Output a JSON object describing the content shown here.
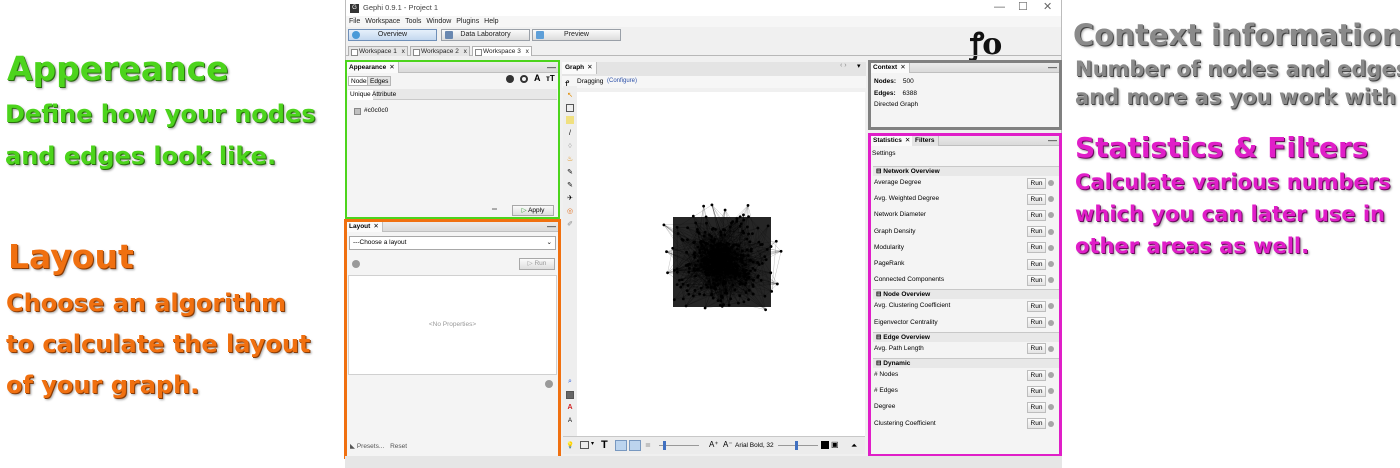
{
  "annotations": {
    "appearance": {
      "title": "Appereance",
      "line1": "Define how your nodes",
      "line2": "and edges look like."
    },
    "layout": {
      "title": "Layout",
      "line1": "Choose an algorithm",
      "line2": "to calculate the layout",
      "line3": "of your graph."
    },
    "context": {
      "title": "Context information",
      "line1": "Number of nodes and edges",
      "line2": "and more as you work with it."
    },
    "stats": {
      "title": "Statistics & Filters",
      "line1": "Calculate various numbers",
      "line2": "which you can later use in",
      "line3": "other areas as well."
    },
    "colors": {
      "appearance": "#4cd41c",
      "layout": "#f07010",
      "context": "#8a8a8a",
      "stats": "#e01ec8"
    }
  },
  "window": {
    "title": "Gephi 0.9.1 - Project 1",
    "app_icon": "gephi-icon",
    "controls": {
      "minimize": "—",
      "maximize": "☐",
      "close": "✕"
    },
    "logo": "ꝭo"
  },
  "menu": [
    "File",
    "Workspace",
    "Tools",
    "Window",
    "Plugins",
    "Help"
  ],
  "modes": [
    {
      "label": "Overview",
      "active": true
    },
    {
      "label": "Data Laboratory",
      "active": false
    },
    {
      "label": "Preview",
      "active": false
    }
  ],
  "workspaces": [
    {
      "label": "Workspace 1",
      "close": "x"
    },
    {
      "label": "Workspace 2",
      "close": "x"
    },
    {
      "label": "Workspace 3",
      "close": "x"
    }
  ],
  "appearance_panel": {
    "tab": "Appearance",
    "subtabs": [
      "Nodes",
      "Edges"
    ],
    "modes": [
      "Unique",
      "Attribute"
    ],
    "color_value": "#c0c0c0",
    "apply": "Apply",
    "icons": [
      "color-icon",
      "size-icon",
      "label-color-icon",
      "label-size-icon"
    ]
  },
  "layout_panel": {
    "tab": "Layout",
    "select_value": "---Choose a layout",
    "run": "Run",
    "no_properties": "<No Properties>",
    "presets": "Presets...",
    "reset": "Reset"
  },
  "graph_panel": {
    "tab": "Graph",
    "mode_label": "Dragging",
    "configure": "(Configure)",
    "font_label": "Arial Bold, 32"
  },
  "context_panel": {
    "tab": "Context",
    "nodes_label": "Nodes:",
    "nodes_value": "500",
    "edges_label": "Edges:",
    "edges_value": "6388",
    "graph_type": "Directed Graph"
  },
  "stats_panel": {
    "tabs": [
      "Statistics",
      "Filters"
    ],
    "settings": "Settings",
    "run_label": "Run",
    "sections": [
      {
        "title": "Network Overview",
        "items": [
          "Average Degree",
          "Avg. Weighted Degree",
          "Network Diameter",
          "Graph Density",
          "Modularity",
          "PageRank",
          "Connected Components"
        ]
      },
      {
        "title": "Node Overview",
        "items": [
          "Avg. Clustering Coefficient",
          "Eigenvector Centrality"
        ]
      },
      {
        "title": "Edge Overview",
        "items": [
          "Avg. Path Length"
        ]
      },
      {
        "title": "Dynamic",
        "items": [
          "# Nodes",
          "# Edges",
          "Degree",
          "Clustering Coefficient"
        ]
      }
    ]
  }
}
